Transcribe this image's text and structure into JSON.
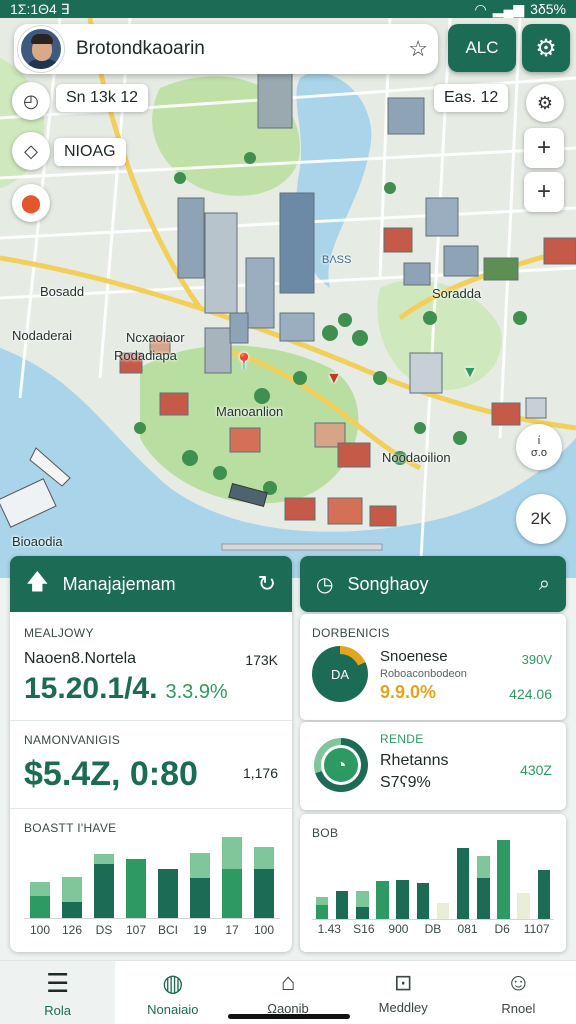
{
  "status_bar": {
    "time": "1Σ:1Θ4 ∃",
    "battery": "3δ5%"
  },
  "header": {
    "search_title": "Brotondkaoarin",
    "top_button": "ALC"
  },
  "map": {
    "chips": {
      "top_left": "Sn 13k 12",
      "top_right": "Eas. 12",
      "mid_left": "NIOAG"
    },
    "badges": {
      "right_small": "ί\nσ.ο",
      "right_large": "2K"
    },
    "labels": {
      "water": "ΒΛSS",
      "west": "Bosadd",
      "east": "Soradda",
      "park_a": "Ncxaoiaor",
      "park_b": "Nodaderai",
      "park_c": "Rodadiapa",
      "center": "Manoanlion",
      "south": "Noodaoilion",
      "shore": "Bioaodia"
    }
  },
  "card_left": {
    "title": "Manajajemam",
    "sec1": {
      "caption": "MEALJOWY",
      "label": "Naoen8.Nortela",
      "right_value": "173K",
      "big_value_a": "15.20.1/4.",
      "big_value_b": "3.3.9%"
    },
    "sec2": {
      "caption": "NAMONVANIGIS",
      "big_value": "$5.4Z, 0:80",
      "right_value": "1,176"
    },
    "sec3": {
      "caption": "BOASTT I'HAVE",
      "x_labels": [
        "100",
        "126",
        "DS",
        "107",
        "BCI",
        "19",
        "17",
        "100"
      ]
    }
  },
  "card_right": {
    "title": "Songhaoy",
    "sec1": {
      "caption": "DORBENICIS",
      "donut_label": "DA",
      "name": "Snoenese",
      "sub": "Roboaconbodeon",
      "value_pct": "9.9.0%",
      "right_top": "390V",
      "right_bottom": "424.06"
    },
    "sec2": {
      "caption": "RENDE",
      "name": "Rhetanns",
      "value": "S7ʕ9%",
      "right_value": "430Z"
    },
    "sec3": {
      "caption": "BOB",
      "x_labels": [
        "1.43",
        "S16",
        "900",
        "DB",
        "081",
        "D6",
        "1107"
      ]
    }
  },
  "chart_left_values": [
    {
      "dark": 22,
      "light": 14
    },
    {
      "dark": 16,
      "light": 26
    },
    {
      "dark": 55,
      "light": 10
    },
    {
      "dark": 60,
      "light": 0
    },
    {
      "dark": 50,
      "light": 0
    },
    {
      "dark": 40,
      "light": 26
    },
    {
      "dark": 50,
      "light": 32
    },
    {
      "dark": 50,
      "light": 22
    }
  ],
  "chart_right_values": [
    {
      "dark": 14,
      "light": 8
    },
    {
      "dark": 28,
      "light": 0
    },
    {
      "dark": 12,
      "light": 16
    },
    {
      "dark": 38,
      "light": 0
    },
    {
      "dark": 40,
      "light": 0
    },
    {
      "dark": 36,
      "light": 0
    },
    {
      "dark": 0,
      "light": 16
    },
    {
      "dark": 72,
      "light": 0
    },
    {
      "dark": 42,
      "light": 22
    },
    {
      "dark": 80,
      "light": 0
    },
    {
      "dark": 0,
      "light": 26
    },
    {
      "dark": 50,
      "light": 0
    }
  ],
  "nav": [
    {
      "label": "Rola",
      "icon": "menu-icon"
    },
    {
      "label": "Nonaiaio",
      "icon": "globe-icon"
    },
    {
      "label": "Ωaonib",
      "icon": "home-icon"
    },
    {
      "label": "Meddley",
      "icon": "chart-icon"
    },
    {
      "label": "Rnoel",
      "icon": "profile-icon"
    }
  ],
  "colors": {
    "brand": "#1c6b55",
    "accent_yellow": "#e3a51f",
    "accent_green": "#2e9a63",
    "light_green": "#7fc79a",
    "pale": "#e9efd6"
  }
}
